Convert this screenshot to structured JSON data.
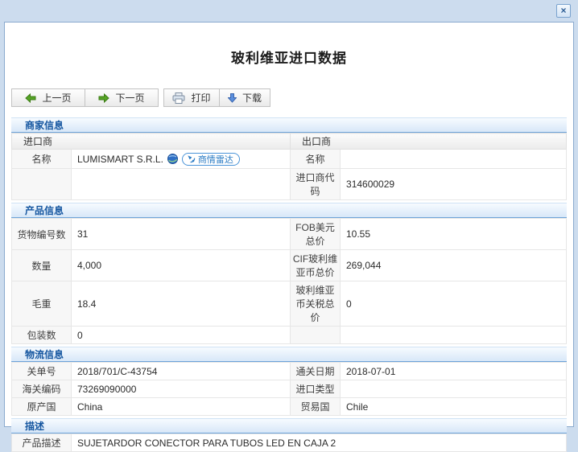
{
  "window": {
    "close_label": "×"
  },
  "page": {
    "title": "玻利维亚进口数据"
  },
  "toolbar": {
    "prev_label": "上一页",
    "next_label": "下一页",
    "print_label": "打印",
    "download_label": "下载"
  },
  "merchant": {
    "header": "商家信息",
    "importer_header": "进口商",
    "exporter_header": "出口商",
    "importer_name_label": "名称",
    "importer_name": "LUMISMART S.R.L.",
    "radar_badge_label": "商情雷达",
    "exporter_name_label": "名称",
    "exporter_name": "",
    "importer_code_label": "进口商代码",
    "importer_code": "314600029"
  },
  "product": {
    "header": "产品信息",
    "rows": [
      {
        "l1": "货物编号数",
        "v1": "31",
        "l2": "FOB美元总价",
        "v2": "10.55"
      },
      {
        "l1": "数量",
        "v1": "4,000",
        "l2": "CIF玻利维亚币总价",
        "v2": "269,044"
      },
      {
        "l1": "毛重",
        "v1": "18.4",
        "l2": "玻利维亚币关税总价",
        "v2": "0"
      },
      {
        "l1": "包装数",
        "v1": "0",
        "l2": "",
        "v2": ""
      }
    ]
  },
  "logistics": {
    "header": "物流信息",
    "rows": [
      {
        "l1": "关单号",
        "v1": "2018/701/C-43754",
        "l2": "通关日期",
        "v2": "2018-07-01"
      },
      {
        "l1": "海关编码",
        "v1": "73269090000",
        "l2": "进口类型",
        "v2": ""
      },
      {
        "l1": "原产国",
        "v1": "China",
        "l2": "贸易国",
        "v2": "Chile"
      }
    ]
  },
  "description": {
    "header": "描述",
    "label": "产品描述",
    "value": "SUJETARDOR CONECTOR PARA TUBOS LED EN CAJA 2"
  },
  "icons": {
    "close": "close-icon",
    "prev": "arrow-left-icon",
    "next": "arrow-right-icon",
    "print": "printer-icon",
    "download": "download-arrow-icon",
    "globe": "globe-icon",
    "radar": "radar-icon"
  },
  "colors": {
    "frame_bg": "#ccdcee",
    "panel_border": "#8aaace",
    "section_header_text": "#1556a0",
    "section_header_border": "#6da3d9",
    "label_cell_bg": "#f7f7f7",
    "badge_blue": "#2a7bc4",
    "arrow_green": "#56a426",
    "arrow_blue": "#5b8fdd"
  }
}
